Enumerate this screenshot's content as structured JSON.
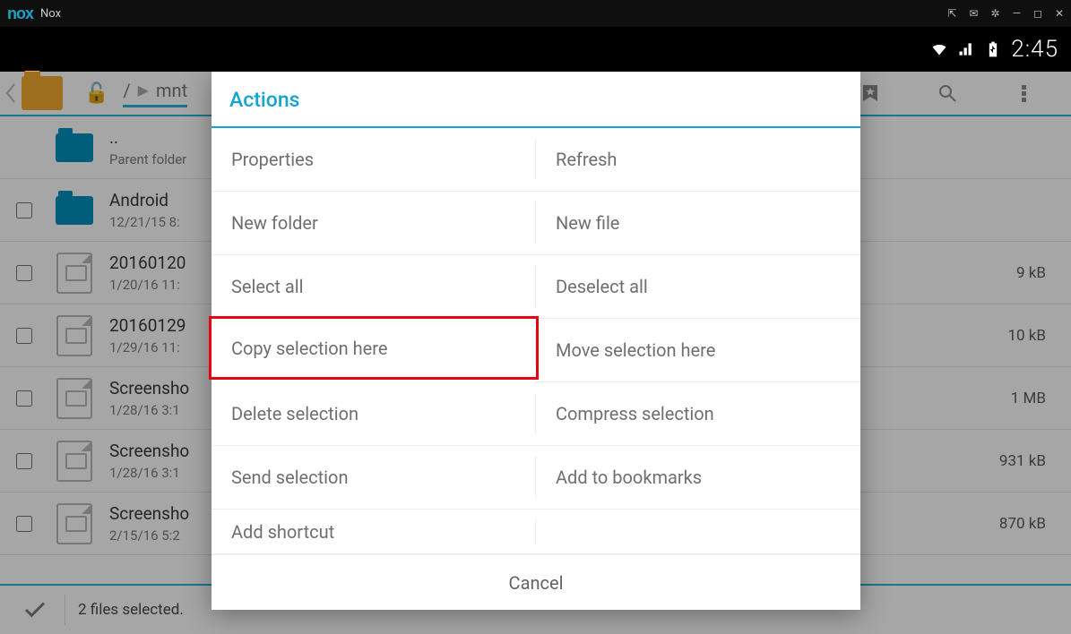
{
  "nox": {
    "title": "Nox"
  },
  "status": {
    "clock": "2:45"
  },
  "breadcrumbs": {
    "root": "/",
    "path1": "mnt"
  },
  "files": [
    {
      "name": "..",
      "meta": "Parent folder",
      "size": "",
      "icon": "folder",
      "checkbox": false
    },
    {
      "name": "Android",
      "meta": "12/21/15 8:",
      "size": "",
      "icon": "folder",
      "checkbox": true
    },
    {
      "name": "20160120",
      "meta": "1/20/16 11:",
      "size": "9 kB",
      "icon": "img",
      "checkbox": true
    },
    {
      "name": "20160129",
      "meta": "1/29/16 11:",
      "size": "10 kB",
      "icon": "img",
      "checkbox": true
    },
    {
      "name": "Screensho",
      "meta": "1/28/16 3:1",
      "size": "1 MB",
      "icon": "img",
      "checkbox": true
    },
    {
      "name": "Screensho",
      "meta": "1/28/16 3:1",
      "size": "931 kB",
      "icon": "img",
      "checkbox": true
    },
    {
      "name": "Screensho",
      "meta": "2/15/16 5:2",
      "size": "870 kB",
      "icon": "img",
      "checkbox": true
    }
  ],
  "selection_bar": {
    "text": "2 files selected."
  },
  "modal": {
    "title": "Actions",
    "items": [
      [
        "Properties",
        "Refresh"
      ],
      [
        "New folder",
        "New file"
      ],
      [
        "Select all",
        "Deselect all"
      ],
      [
        "Copy selection here",
        "Move selection here"
      ],
      [
        "Delete selection",
        "Compress selection"
      ],
      [
        "Send selection",
        "Add to bookmarks"
      ],
      [
        "Add shortcut",
        ""
      ]
    ],
    "cancel": "Cancel",
    "highlighted": "Copy selection here"
  }
}
